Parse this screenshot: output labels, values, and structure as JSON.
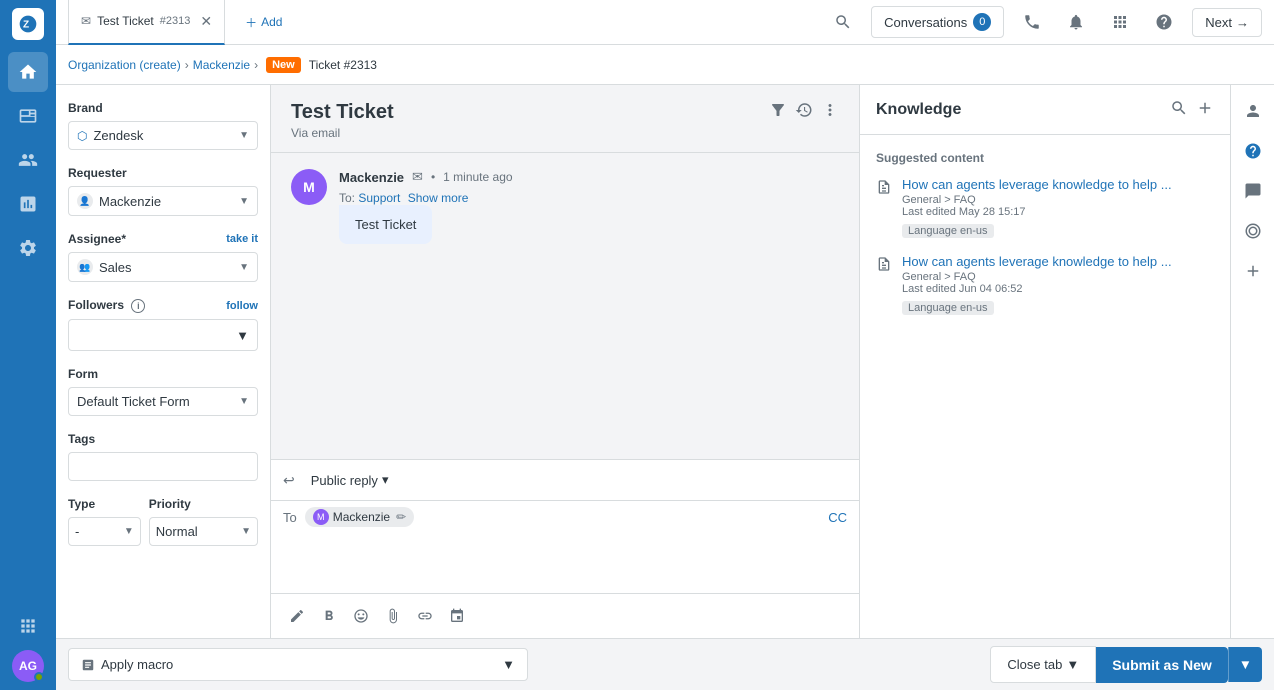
{
  "nav": {
    "logo_initial": "Z",
    "items": [
      {
        "name": "home",
        "icon": "home",
        "active": false
      },
      {
        "name": "tickets",
        "icon": "tickets",
        "active": true
      },
      {
        "name": "contacts",
        "icon": "contacts",
        "active": false
      },
      {
        "name": "reporting",
        "icon": "reporting",
        "active": false
      },
      {
        "name": "settings",
        "icon": "settings",
        "active": false
      },
      {
        "name": "apps",
        "icon": "apps",
        "active": false
      }
    ],
    "avatar_initials": "AG"
  },
  "topbar": {
    "tab_label": "Test Ticket",
    "tab_id": "#2313",
    "add_label": "Add",
    "conversations_label": "Conversations",
    "conversations_count": "0",
    "next_label": "Next"
  },
  "breadcrumb": {
    "org_label": "Organization (create)",
    "user_label": "Mackenzie",
    "status_label": "New",
    "ticket_label": "Ticket #2313"
  },
  "ticket_fields": {
    "brand_label": "Brand",
    "brand_value": "Zendesk",
    "requester_label": "Requester",
    "requester_value": "Mackenzie",
    "assignee_label": "Assignee*",
    "assignee_take_it": "take it",
    "assignee_value": "Sales",
    "followers_label": "Followers",
    "followers_info": "i",
    "followers_follow": "follow",
    "form_label": "Form",
    "form_value": "Default Ticket Form",
    "tags_label": "Tags",
    "type_label": "Type",
    "type_value": "-",
    "priority_label": "Priority",
    "priority_value": "Normal"
  },
  "ticket": {
    "title": "Test Ticket",
    "source": "Via email",
    "message": {
      "author": "Mackenzie",
      "time": "1 minute ago",
      "to_label": "To:",
      "to_value": "Support",
      "show_more": "Show more",
      "content": "Test Ticket"
    }
  },
  "reply": {
    "type_label": "Public reply",
    "to_label": "To",
    "to_recipient": "Mackenzie",
    "cc_label": "CC"
  },
  "knowledge": {
    "title": "Knowledge",
    "suggested_label": "Suggested content",
    "articles": [
      {
        "title": "How can agents leverage knowledge to help ...",
        "category": "General > FAQ",
        "edited": "Last edited May 28 15:17",
        "language": "Language",
        "language_tag": "en-us"
      },
      {
        "title": "How can agents leverage knowledge to help ...",
        "category": "General > FAQ",
        "edited": "Last edited Jun 04 06:52",
        "language": "Language",
        "language_tag": "en-us"
      }
    ]
  },
  "bottom": {
    "apply_macro_label": "Apply macro",
    "close_tab_label": "Close tab",
    "submit_label": "Submit as New"
  }
}
